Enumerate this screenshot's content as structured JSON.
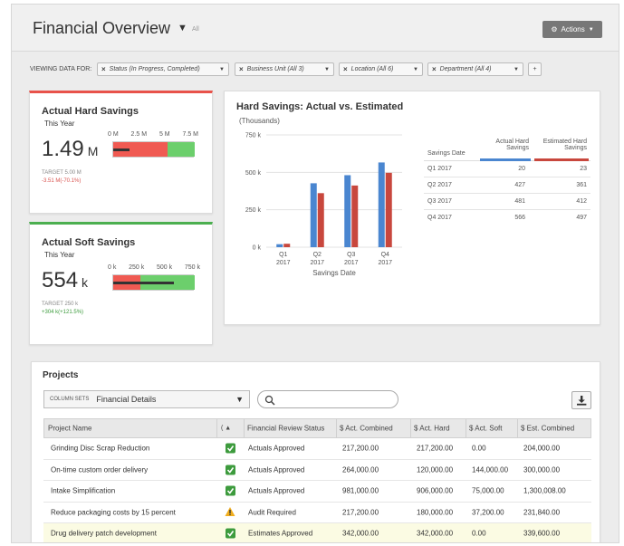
{
  "header": {
    "title": "Financial Overview",
    "title_sub": "All",
    "actions_label": "Actions"
  },
  "filters": {
    "label": "VIEWING DATA FOR:",
    "chips": [
      {
        "label": "Status (In Progress, Completed)"
      },
      {
        "label": "Business Unit (All 3)"
      },
      {
        "label": "Location (All 6)"
      },
      {
        "label": "Department (All 4)"
      }
    ],
    "add_label": "+"
  },
  "kpi_hard": {
    "title": "Actual Hard Savings",
    "subtitle": "This Year",
    "value": "1.49",
    "unit": "M",
    "scale": [
      "0 M",
      "2.5 M",
      "5 M",
      "7.5 M"
    ],
    "target": "TARGET 5.00 M",
    "delta": "-3.51 M(-70.1%)",
    "delta_color": "#d9534f",
    "actual_fraction": 0.199,
    "target_fraction": 0.667,
    "accent": "#e8524a"
  },
  "kpi_soft": {
    "title": "Actual Soft Savings",
    "subtitle": "This Year",
    "value": "554",
    "unit": "k",
    "scale": [
      "0 k",
      "250 k",
      "500 k",
      "750 k"
    ],
    "target": "TARGET 250 k",
    "delta": "+304 k(+121.5%)",
    "delta_color": "#3a9a3a",
    "actual_fraction": 0.739,
    "target_fraction": 0.333,
    "accent": "#4caf50"
  },
  "hard_chart": {
    "title": "Hard Savings: Actual vs. Estimated",
    "subtitle": "(Thousands)",
    "table_headers": {
      "date": "Savings Date",
      "actual": "Actual Hard Savings",
      "estimated": "Estimated Hard Savings"
    },
    "colors": {
      "actual": "#4a86d0",
      "estimated": "#c8473d"
    }
  },
  "chart_data": {
    "type": "bar",
    "title": "Hard Savings: Actual vs. Estimated",
    "subtitle": "(Thousands)",
    "xlabel": "Savings Date",
    "ylabel": "",
    "categories": [
      "Q1 2017",
      "Q2 2017",
      "Q3 2017",
      "Q4 2017"
    ],
    "series": [
      {
        "name": "Actual Hard Savings",
        "values": [
          20,
          427,
          481,
          566
        ]
      },
      {
        "name": "Estimated Hard Savings",
        "values": [
          23,
          361,
          412,
          497
        ]
      }
    ],
    "ylim": [
      0,
      750
    ],
    "yticks": [
      "0 k",
      "250 k",
      "500 k",
      "750 k"
    ],
    "grid": true
  },
  "projects": {
    "title": "Projects",
    "colsets_label": "COLUMN SETS",
    "colsets_value": "Financial Details",
    "columns": [
      "Project Name",
      "( ▲",
      "Financial Review Status",
      "$ Act. Combined",
      "$ Act. Hard",
      "$ Act. Soft",
      "$ Est. Combined"
    ],
    "rows": [
      {
        "name": "Grinding Disc Scrap Reduction",
        "icon": "check-icon",
        "status": "Actuals Approved",
        "act_combined": "217,200.00",
        "act_hard": "217,200.00",
        "act_soft": "0.00",
        "est_combined": "204,000.00"
      },
      {
        "name": "On-time custom order delivery",
        "icon": "check-icon",
        "status": "Actuals Approved",
        "act_combined": "264,000.00",
        "act_hard": "120,000.00",
        "act_soft": "144,000.00",
        "est_combined": "300,000.00"
      },
      {
        "name": "Intake Simplification",
        "icon": "check-icon",
        "status": "Actuals Approved",
        "act_combined": "981,000.00",
        "act_hard": "906,000.00",
        "act_soft": "75,000.00",
        "est_combined": "1,300,008.00"
      },
      {
        "name": "Reduce packaging costs by 15 percent",
        "icon": "warning-icon",
        "status": "Audit Required",
        "act_combined": "217,200.00",
        "act_hard": "180,000.00",
        "act_soft": "37,200.00",
        "est_combined": "231,840.00"
      },
      {
        "name": "Drug delivery patch development",
        "icon": "check-icon",
        "status": "Estimates Approved",
        "act_combined": "342,000.00",
        "act_hard": "342,000.00",
        "act_soft": "0.00",
        "est_combined": "339,600.00"
      }
    ]
  }
}
